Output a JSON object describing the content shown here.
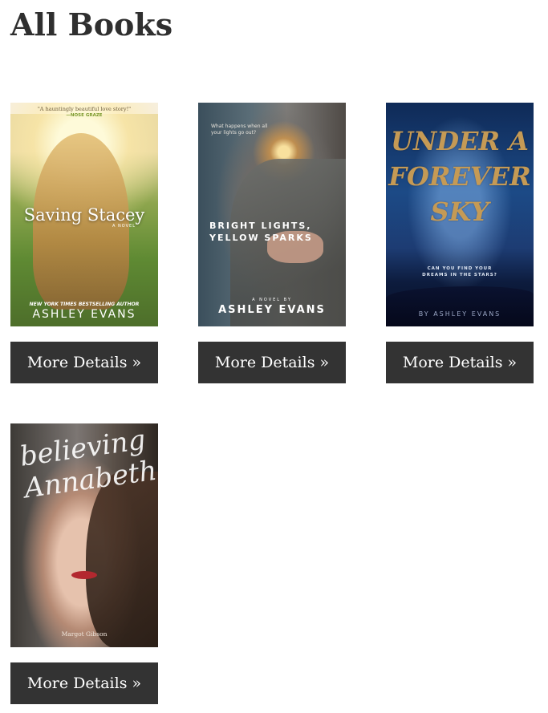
{
  "page": {
    "title": "All Books"
  },
  "books": [
    {
      "cover": {
        "quote": "\"A hauntingly beautiful love story!\"",
        "quote_by": "—NOSE GRAZE",
        "title": "Saving Stacey",
        "subtitle": "A NOVEL",
        "tagline": "NEW YORK TIMES BESTSELLING AUTHOR",
        "author": "ASHLEY EVANS"
      },
      "button": "More Details »"
    },
    {
      "cover": {
        "quote": "What happens when all your lights go out?",
        "title": "BRIGHT LIGHTS,\nYELLOW SPARKS",
        "subtitle": "A NOVEL BY",
        "author": "ASHLEY EVANS"
      },
      "button": "More Details »"
    },
    {
      "cover": {
        "title": "UNDER A\nFOREVER\nSKY",
        "tagline": "CAN YOU FIND YOUR\nDREAMS IN THE STARS?",
        "author": "BY ASHLEY EVANS"
      },
      "button": "More Details »"
    },
    {
      "cover": {
        "title": "believing\nAnnabeth",
        "author": "Margot Gibson"
      },
      "button": "More Details »"
    }
  ]
}
